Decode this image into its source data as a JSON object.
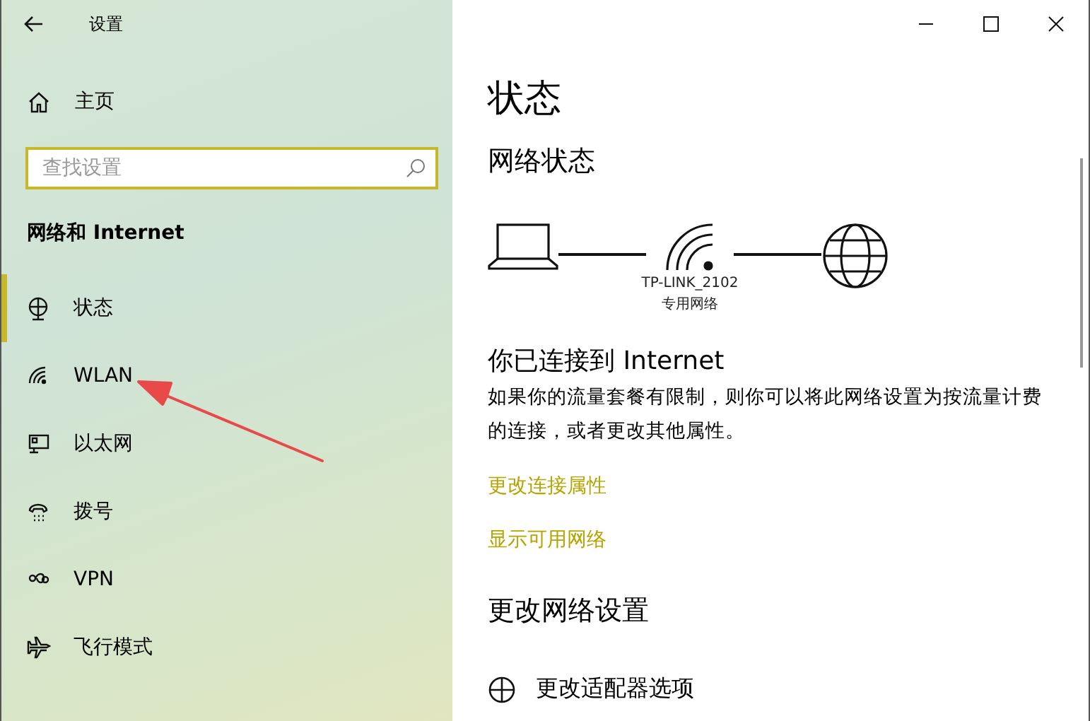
{
  "window": {
    "title": "设置"
  },
  "sidebar": {
    "home": "主页",
    "search": {
      "placeholder": "查找设置"
    },
    "section": "网络和 Internet",
    "items": [
      {
        "label": "状态",
        "kind": "status",
        "selected": true
      },
      {
        "label": "WLAN",
        "kind": "wifi",
        "selected": false
      },
      {
        "label": "以太网",
        "kind": "ethernet",
        "selected": false
      },
      {
        "label": "拨号",
        "kind": "dialup",
        "selected": false
      },
      {
        "label": "VPN",
        "kind": "vpn",
        "selected": false
      },
      {
        "label": "飞行模式",
        "kind": "airplane",
        "selected": false
      }
    ]
  },
  "main": {
    "title": "状态",
    "network_status": {
      "heading": "网络状态",
      "network_name": "TP-LINK_2102",
      "network_type": "专用网络"
    },
    "connection": {
      "heading": "你已连接到 Internet",
      "description": "如果你的流量套餐有限制，则你可以将此网络设置为按流量计费的连接，或者更改其他属性。",
      "links": [
        "更改连接属性",
        "显示可用网络"
      ]
    },
    "change_settings": {
      "heading": "更改网络设置",
      "items": [
        {
          "label": "更改适配器选项"
        }
      ]
    }
  }
}
